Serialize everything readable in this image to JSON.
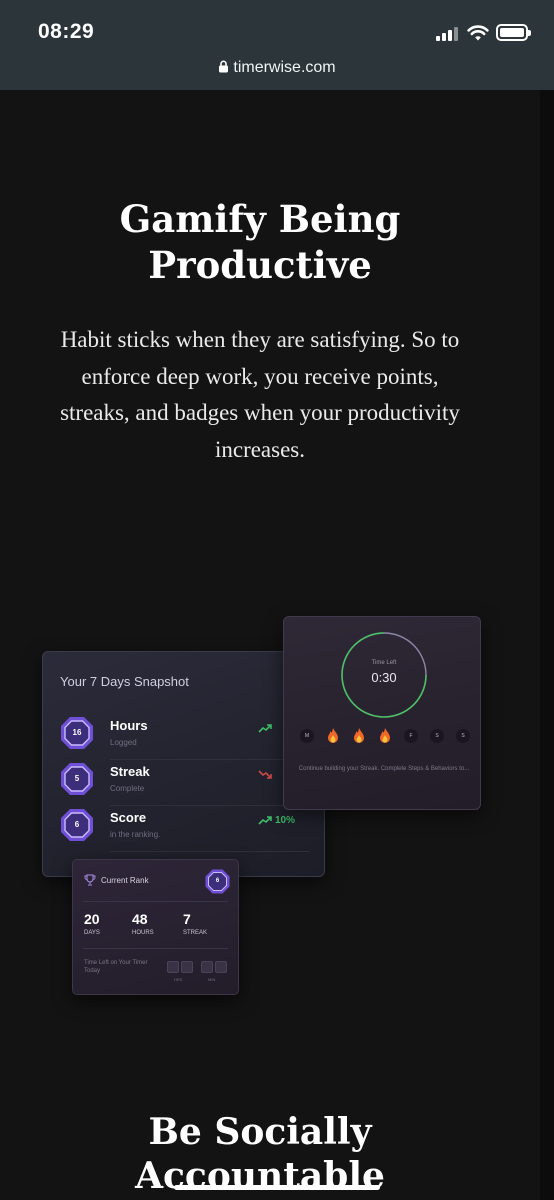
{
  "status_bar": {
    "time": "08:29",
    "url": "timerwise.com"
  },
  "hero": {
    "title": "Gamify Being Productive",
    "body": "Habit sticks when they are satisfying. So to enforce deep work, you receive points, streaks, and badges when your productivity increases."
  },
  "snapshot": {
    "title": "Your 7 Days Snapshot",
    "rows": [
      {
        "badge": "16",
        "label": "Hours",
        "sub": "Logged",
        "trend": "up",
        "pct": ""
      },
      {
        "badge": "5",
        "label": "Streak",
        "sub": "Complete",
        "trend": "down",
        "pct": ""
      },
      {
        "badge": "6",
        "label": "Score",
        "sub": "in the ranking.",
        "trend": "up",
        "pct": "10%"
      }
    ]
  },
  "timer": {
    "label": "Time Left",
    "value": "0:30",
    "days": [
      "M",
      "fire",
      "fire",
      "fire",
      "F",
      "S",
      "S"
    ],
    "continue_text": "Continue building your Streak. Complete Steps & Behaviors to..."
  },
  "rank": {
    "title": "Current Rank",
    "badge": "6",
    "stats": [
      {
        "value": "20",
        "label": "DAYS"
      },
      {
        "value": "48",
        "label": "HOURS"
      },
      {
        "value": "7",
        "label": "STREAK"
      }
    ],
    "time_left": "Time Left on Your Timer Today",
    "digit_labels": [
      "HRS",
      "MIN"
    ]
  },
  "next_section": {
    "title": "Be Socially Accountable"
  },
  "colors": {
    "background": "#131313",
    "accent_purple": "#6f4fd6",
    "trend_up": "#3fbf6a",
    "trend_down": "#d04a4a",
    "timer_ring": "#4fc06a"
  },
  "icons": [
    "lock-icon",
    "signal-icon",
    "wifi-icon",
    "battery-icon",
    "trophy-icon",
    "fire-icon",
    "trend-up-icon",
    "trend-down-icon"
  ]
}
